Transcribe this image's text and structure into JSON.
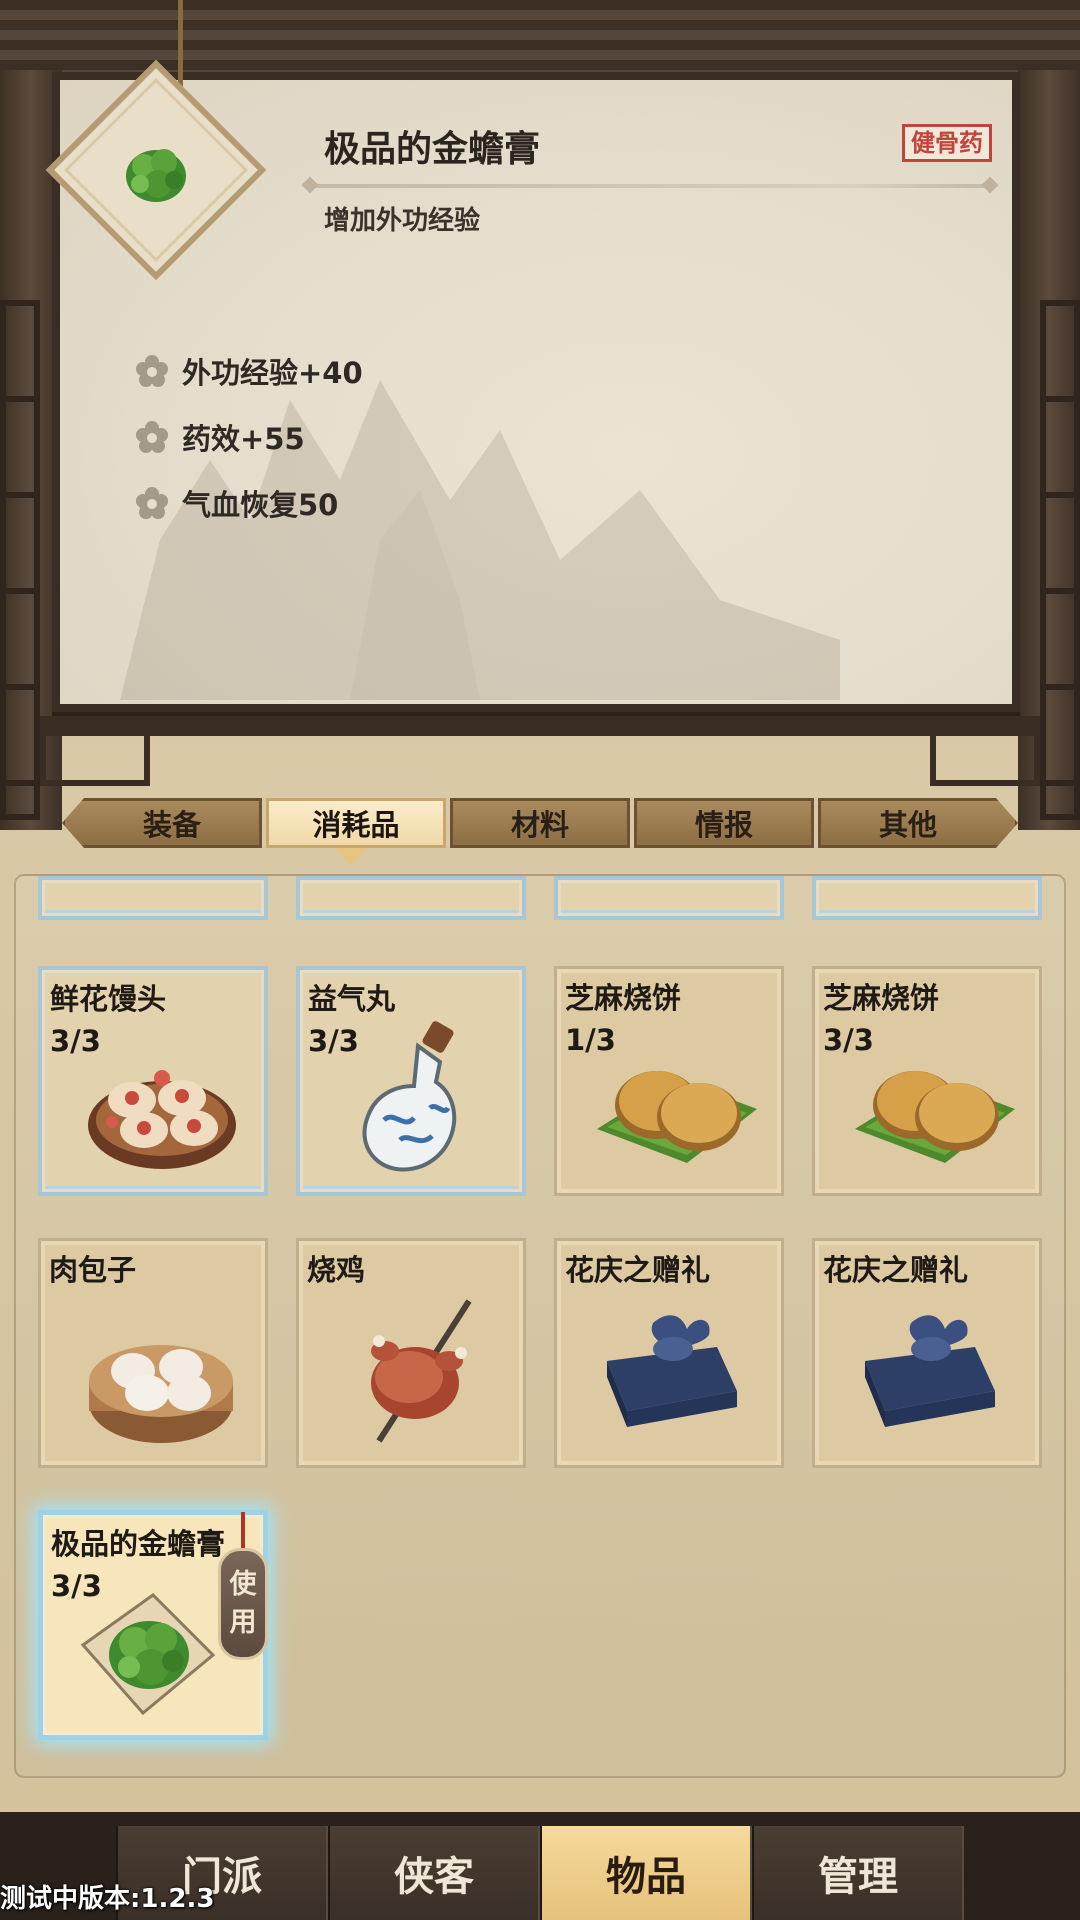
{
  "detail": {
    "title": "极品的金蟾膏",
    "tag": "健骨药",
    "description": "增加外功经验",
    "stats": [
      "外功经验+40",
      "药效+55",
      "气血恢复50"
    ]
  },
  "tabs": [
    "装备",
    "消耗品",
    "材料",
    "情报",
    "其他"
  ],
  "active_tab": "消耗品",
  "inventory": [
    {
      "name": "鲜花馒头",
      "qty": "3/3",
      "icon": "flower-bun-icon"
    },
    {
      "name": "益气丸",
      "qty": "3/3",
      "icon": "pill-bottle-icon"
    },
    {
      "name": "芝麻烧饼",
      "qty": "1/3",
      "icon": "sesame-cake-icon"
    },
    {
      "name": "芝麻烧饼",
      "qty": "3/3",
      "icon": "sesame-cake-icon"
    },
    {
      "name": "肉包子",
      "qty": "",
      "icon": "meat-bun-icon"
    },
    {
      "name": "烧鸡",
      "qty": "",
      "icon": "roast-chicken-icon"
    },
    {
      "name": "花庆之赠礼",
      "qty": "",
      "icon": "gift-bundle-icon"
    },
    {
      "name": "花庆之赠礼",
      "qty": "",
      "icon": "gift-bundle-icon"
    },
    {
      "name": "极品的金蟾膏",
      "qty": "3/3",
      "icon": "herb-paste-icon"
    }
  ],
  "use_button": [
    "使",
    "用"
  ],
  "bottom_nav": [
    "门派",
    "侠客",
    "物品",
    "管理"
  ],
  "active_nav": "物品",
  "version": "测试中版本:1.2.3",
  "colors": {
    "tag_red": "#c0463c",
    "active_tab": "#f0d9a8",
    "selected_glow": "#9ee7ff",
    "nav_active": "#e6c27b"
  }
}
